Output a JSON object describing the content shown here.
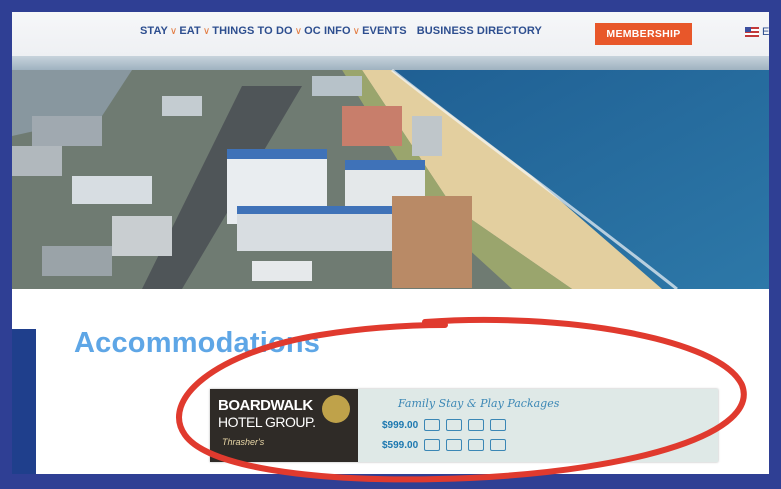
{
  "nav": {
    "items": [
      {
        "label": "STAY",
        "dropdown": true
      },
      {
        "label": "EAT",
        "dropdown": true
      },
      {
        "label": "THINGS TO DO",
        "dropdown": true
      },
      {
        "label": "OC INFO",
        "dropdown": true
      },
      {
        "label": "EVENTS",
        "dropdown": false
      },
      {
        "label": "BUSINESS DIRECTORY",
        "dropdown": false
      }
    ],
    "membership_label": "MEMBERSHIP",
    "language_label": "E",
    "chevron": "∨"
  },
  "page": {
    "title": "Accommodations"
  },
  "ad": {
    "brand_line1": "BOARDWALK",
    "brand_line2": "HOTEL GROUP.",
    "brand_line3": "Thrasher's",
    "headline": "Family Stay & Play Packages",
    "row1_price": "$999.00",
    "row2_price": "$599.00"
  },
  "colors": {
    "accent": "#e8572a",
    "nav_text": "#2d4e8f",
    "title": "#5ea6e6",
    "frame": "#2f3f94",
    "annotation": "#e03a2e"
  }
}
